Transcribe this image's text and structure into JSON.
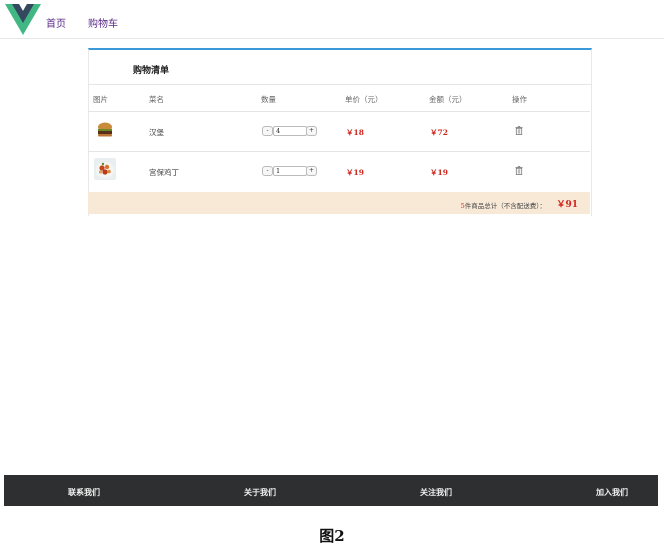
{
  "nav": {
    "home": "首页",
    "cart": "购物车"
  },
  "cart": {
    "title": "购物清单",
    "columns": [
      "图片",
      "菜名",
      "数量",
      "单价（元）",
      "金额（元）",
      "操作"
    ],
    "items": [
      {
        "name": "汉堡",
        "qty": "4",
        "unit_price": "￥18",
        "amount": "￥72",
        "minus": "-",
        "plus": "+"
      },
      {
        "name": "宫保鸡丁",
        "qty": "1",
        "unit_price": "￥19",
        "amount": "￥19",
        "minus": "-",
        "plus": "+"
      }
    ],
    "summary": {
      "count": "5",
      "label": "件商品总计（不含配送费）：",
      "total": "￥91"
    }
  },
  "footer": {
    "links": [
      "联系我们",
      "关于我们",
      "关注我们",
      "加入我们"
    ]
  },
  "caption": "图2",
  "colors": {
    "accent_blue": "#3a9ad9",
    "price_red": "#d0251c",
    "summary_bg": "#f8e9d7",
    "footer_bg": "#2e2f30",
    "nav_purple": "#5b2b8a",
    "logo_green": "#41b883",
    "logo_dark": "#35495e"
  }
}
